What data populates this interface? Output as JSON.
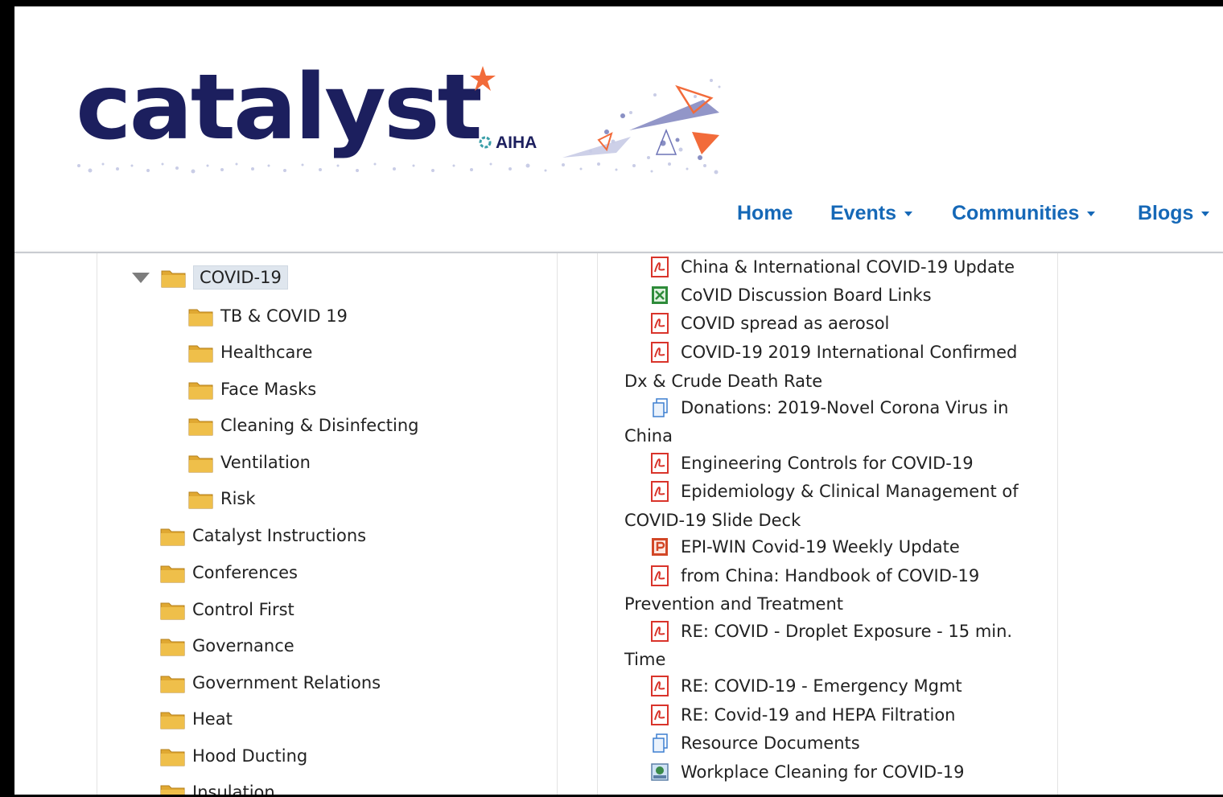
{
  "logo": {
    "wordmark": "catalyst",
    "org": "AIHA"
  },
  "nav": {
    "items": [
      {
        "label": "Home",
        "dropdown": false
      },
      {
        "label": "Events",
        "dropdown": true
      },
      {
        "label": "Communities",
        "dropdown": true
      },
      {
        "label": "Blogs",
        "dropdown": true
      }
    ]
  },
  "tree": {
    "root": {
      "label": "COVID-19",
      "expanded": true,
      "selected": true
    },
    "children": [
      {
        "label": "TB & COVID 19"
      },
      {
        "label": "Healthcare"
      },
      {
        "label": "Face Masks"
      },
      {
        "label": "Cleaning & Disinfecting"
      },
      {
        "label": "Ventilation"
      },
      {
        "label": "Risk"
      }
    ],
    "siblings": [
      {
        "label": "Catalyst Instructions"
      },
      {
        "label": "Conferences"
      },
      {
        "label": "Control First"
      },
      {
        "label": "Governance"
      },
      {
        "label": "Government Relations"
      },
      {
        "label": "Heat"
      },
      {
        "label": "Hood Ducting"
      },
      {
        "label": "Insulation"
      }
    ]
  },
  "files": {
    "items": [
      {
        "icon": "pdf-icon",
        "label": "China & International COVID-19 Update",
        "cont": ""
      },
      {
        "icon": "excel-icon",
        "label": "CoVID Discussion Board Links",
        "cont": ""
      },
      {
        "icon": "pdf-icon",
        "label": "COVID spread as aerosol",
        "cont": ""
      },
      {
        "icon": "pdf-icon",
        "label": "COVID-19 2019 International Confirmed",
        "cont": "Dx & Crude Death Rate"
      },
      {
        "icon": "document-icon",
        "label": "Donations: 2019-Novel Corona Virus in",
        "cont": "China"
      },
      {
        "icon": "pdf-icon",
        "label": "Engineering Controls for COVID-19",
        "cont": ""
      },
      {
        "icon": "pdf-icon",
        "label": "Epidemiology & Clinical Management of",
        "cont": "COVID-19 Slide Deck"
      },
      {
        "icon": "powerpoint-icon",
        "label": "EPI-WIN Covid-19 Weekly Update",
        "cont": ""
      },
      {
        "icon": "pdf-icon",
        "label": "from China: Handbook of COVID-19",
        "cont": "Prevention and Treatment"
      },
      {
        "icon": "pdf-icon",
        "label": "RE: COVID - Droplet Exposure - 15 min.",
        "cont": "Time"
      },
      {
        "icon": "pdf-icon",
        "label": "RE: COVID-19 - Emergency Mgmt",
        "cont": ""
      },
      {
        "icon": "pdf-icon",
        "label": "RE: Covid-19 and HEPA Filtration",
        "cont": ""
      },
      {
        "icon": "document-icon",
        "label": "Resource Documents",
        "cont": ""
      },
      {
        "icon": "image-icon",
        "label": "Workplace Cleaning for COVID-19",
        "cont": ""
      }
    ]
  },
  "colors": {
    "brand_navy": "#1c1f5e",
    "nav_blue": "#1568b7",
    "accent_orange": "#f26b3a",
    "folder_gold": "#e0a832",
    "pdf_red": "#d9342b"
  }
}
